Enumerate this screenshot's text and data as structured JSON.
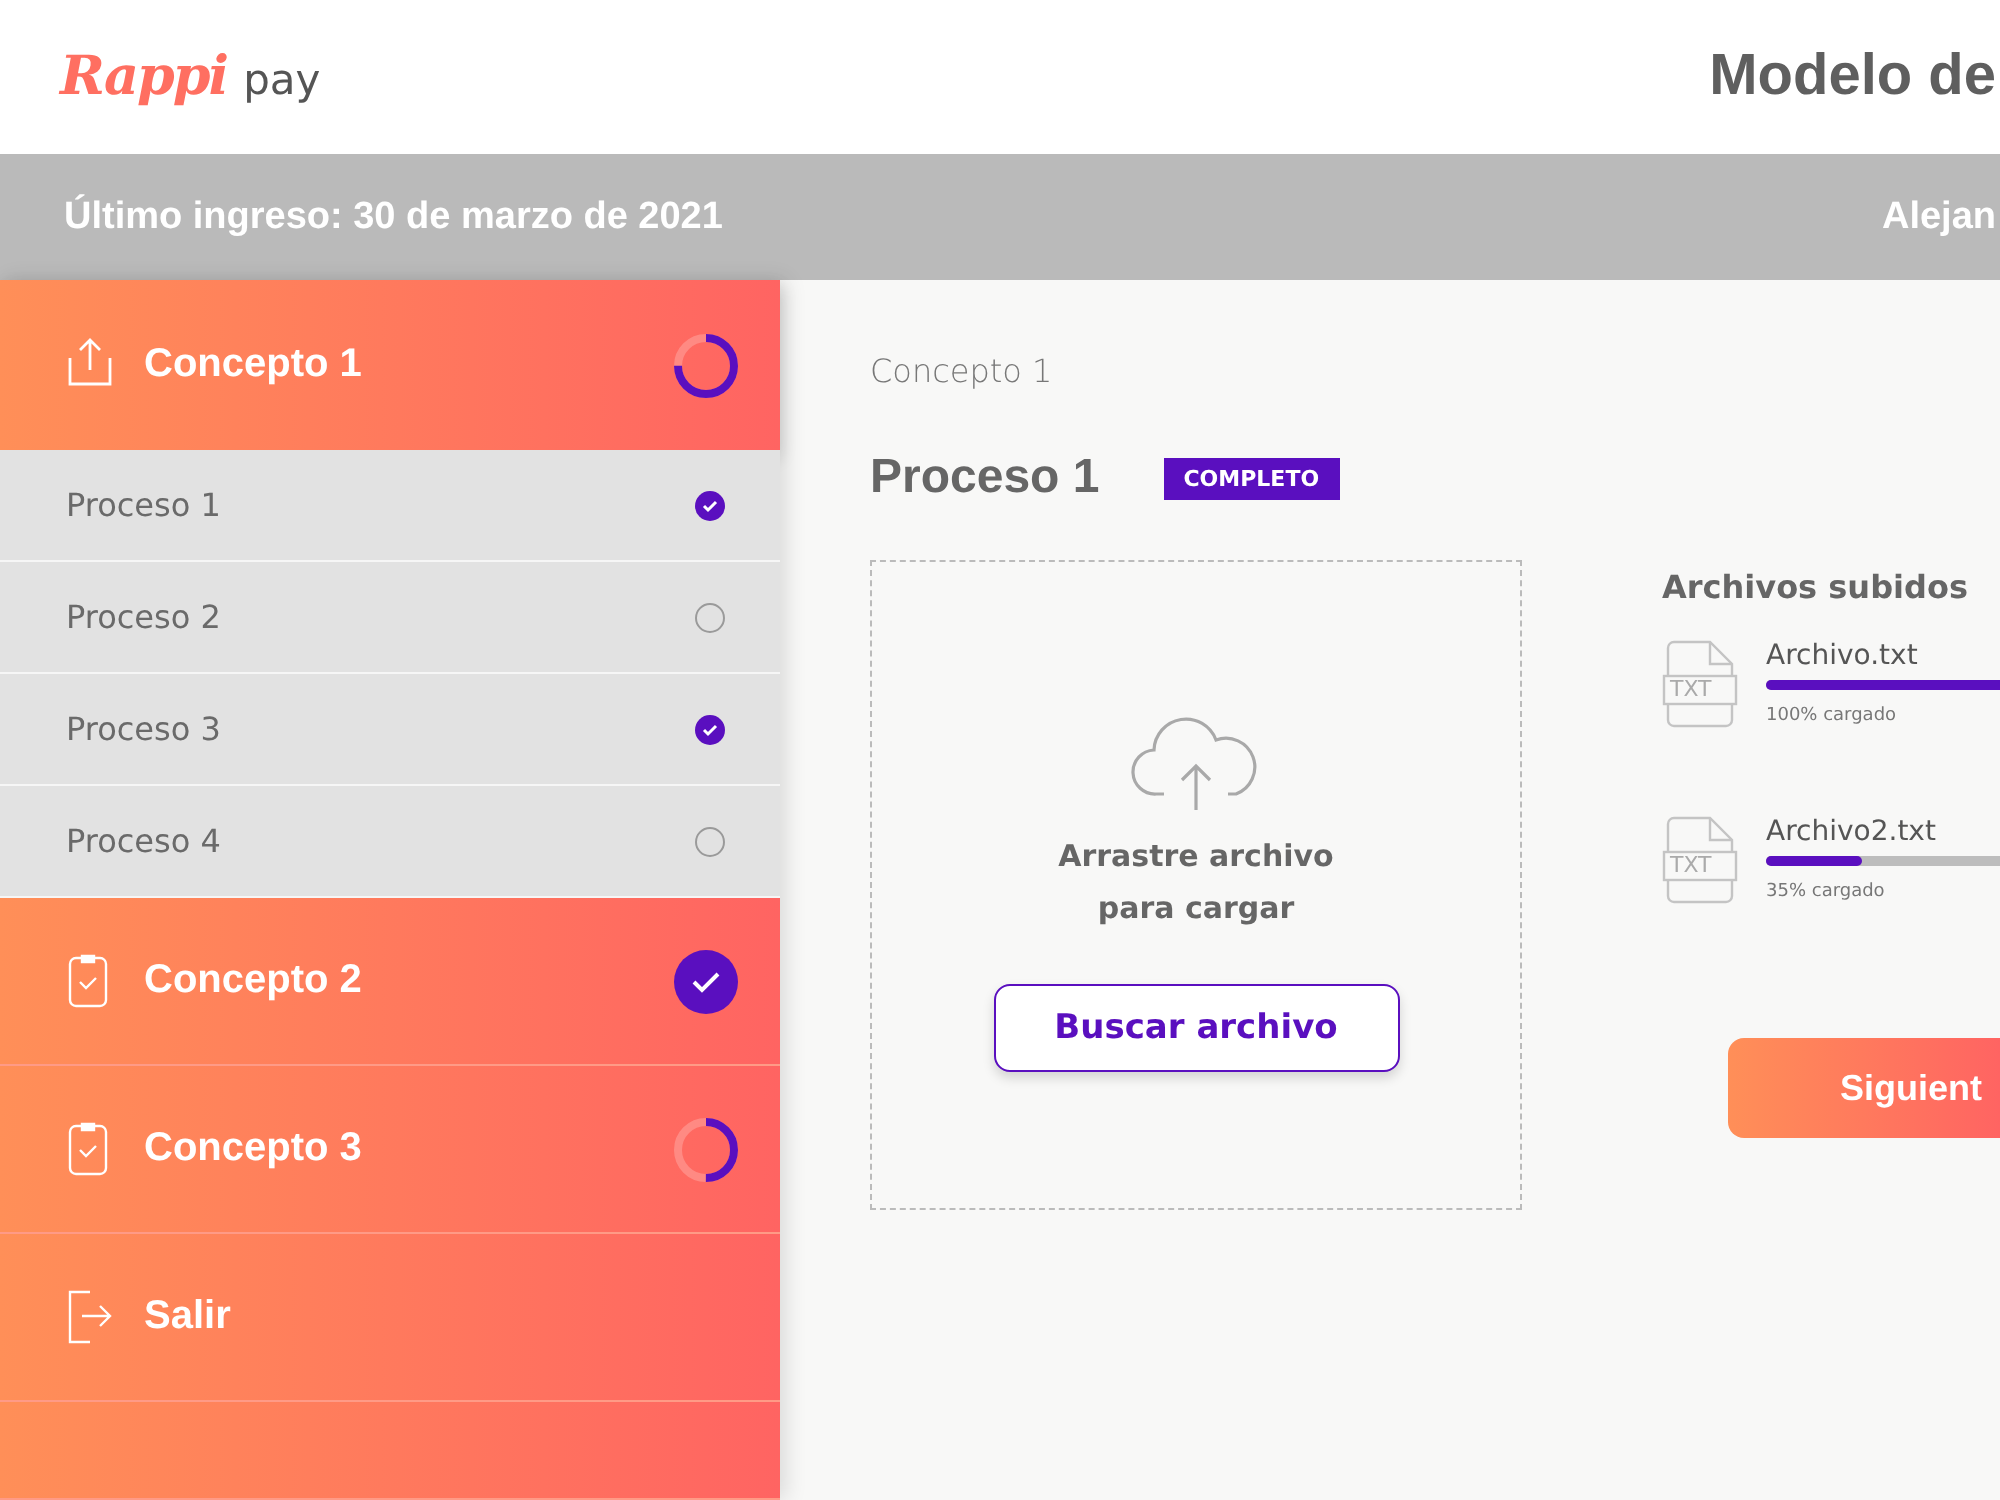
{
  "header": {
    "logo_brand": "Rappi",
    "logo_suffix": "pay",
    "title": "Modelo de"
  },
  "info_bar": {
    "last_login": "Último ingreso: 30 de marzo de 2021",
    "user": "Alejan"
  },
  "sidebar": {
    "items": [
      {
        "label": "Concepto 1",
        "kind": "concept",
        "done": false,
        "level": 0.75,
        "selected": true,
        "children": [
          {
            "label": "Proceso 1",
            "checked": true
          },
          {
            "label": "Proceso 2",
            "checked": false
          },
          {
            "label": "Proceso 3",
            "checked": true
          },
          {
            "label": "Proceso 4",
            "checked": false
          }
        ]
      },
      {
        "label": "Concepto 2",
        "kind": "concept",
        "done": true,
        "selected": false
      },
      {
        "label": "Concepto 3",
        "kind": "concept",
        "done": false,
        "level": 0.5,
        "selected": false
      },
      {
        "label": "Salir",
        "kind": "exit",
        "done": false,
        "selected": false
      }
    ]
  },
  "content": {
    "breadcrumb": "Concepto 1",
    "heading": "Proceso 1",
    "badge": "COMPLETO",
    "dropzone": {
      "text": "Arrastre archivo\npara cargar",
      "button": "Buscar archivo"
    },
    "files": {
      "title": "Archivos subidos",
      "items": [
        {
          "name": "Archivo.txt",
          "icon_text": "TXT",
          "level": 1.0,
          "caption": "100% cargado"
        },
        {
          "name": "Archivo2.txt",
          "icon_text": "TXT",
          "level": 0.35,
          "caption": "35% cargado"
        }
      ]
    },
    "next_button": "Siguient"
  }
}
